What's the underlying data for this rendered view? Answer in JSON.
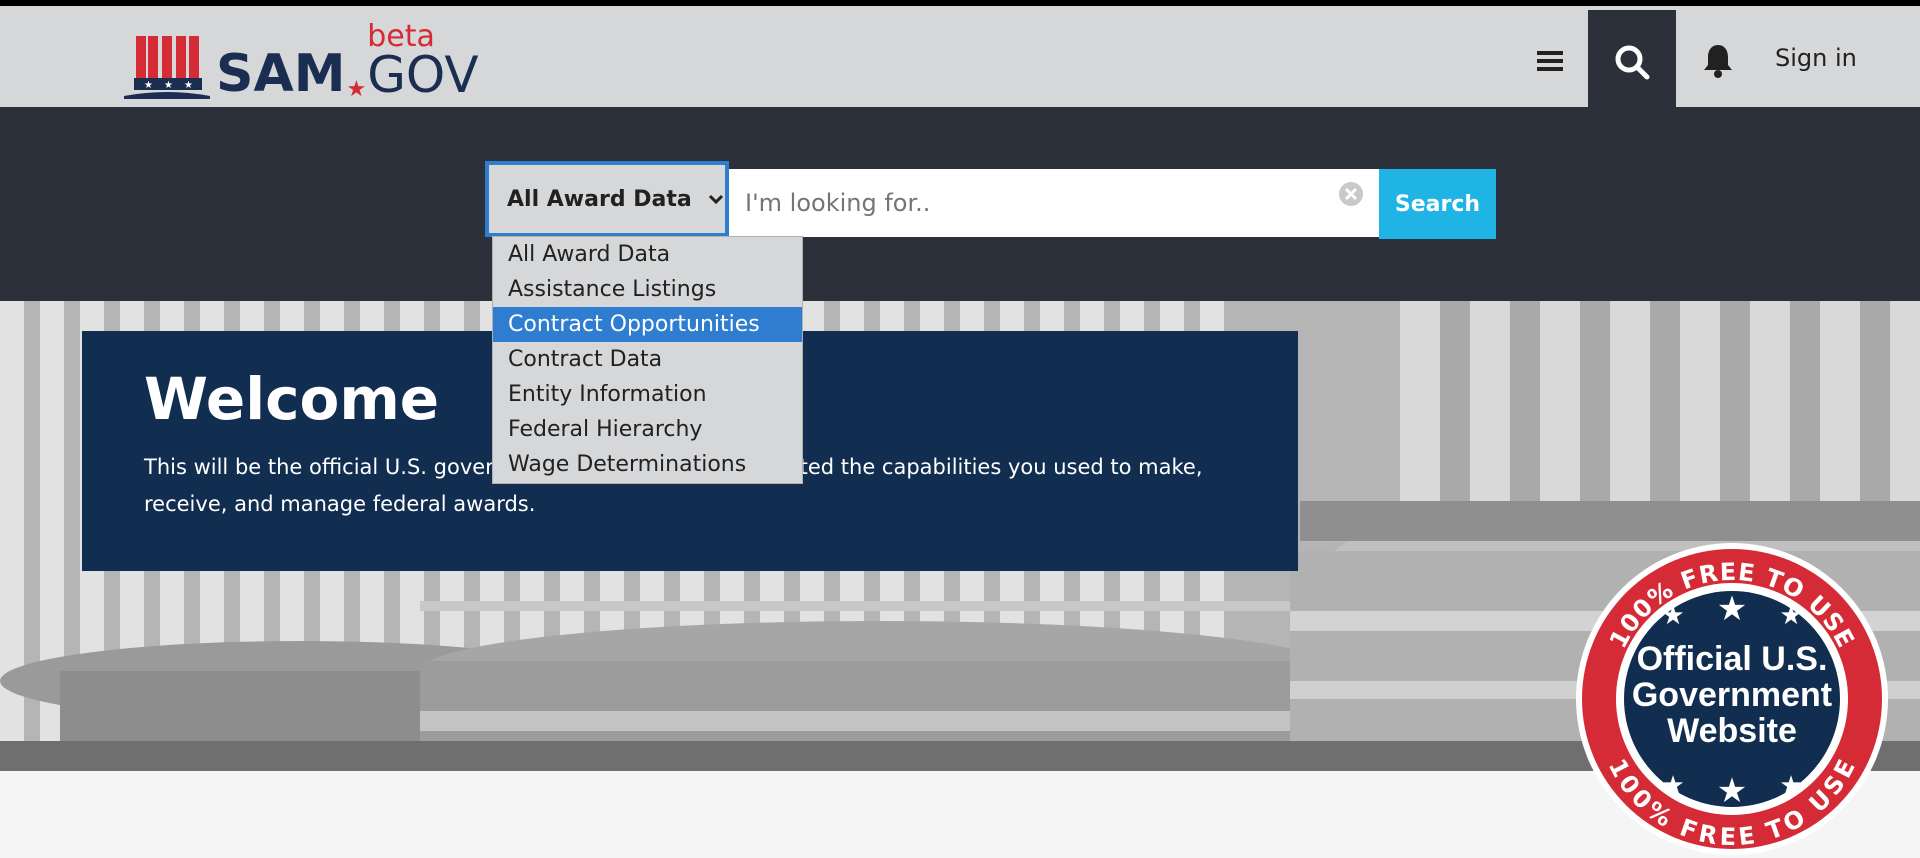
{
  "header": {
    "logo_text": "SAM",
    "logo_gov": "GOV",
    "logo_beta": "beta",
    "signin_label": "Sign in"
  },
  "search": {
    "scope_label": "All Award Data",
    "placeholder": "I'm looking for..",
    "submit_label": "Search",
    "options": [
      "All Award Data",
      "Assistance Listings",
      "Contract Opportunities",
      "Contract Data",
      "Entity Information",
      "Federal Hierarchy",
      "Wage Determinations"
    ],
    "highlighted_option": "Contract Opportunities"
  },
  "hero": {
    "title": "Welcome",
    "text": "This will be the official U.S. government system that consolidated the capabilities you used to make, receive, and manage federal awards."
  },
  "badge": {
    "top_ring": "100% FREE TO USE",
    "bottom_ring": "100% FREE TO USE",
    "line1": "Official U.S.",
    "line2": "Government",
    "line3": "Website"
  },
  "colors": {
    "header_bg": "#d6d7d9",
    "band_bg": "#2b303b",
    "accent_blue": "#2e7dd1",
    "search_cyan": "#1fb4e3",
    "welcome_navy": "#112e51",
    "brand_red": "#d42b36"
  },
  "icons": [
    "hat-logo-icon",
    "hamburger-icon",
    "search-icon",
    "bell-icon",
    "chevron-down-icon",
    "clear-icon",
    "star-icon"
  ]
}
